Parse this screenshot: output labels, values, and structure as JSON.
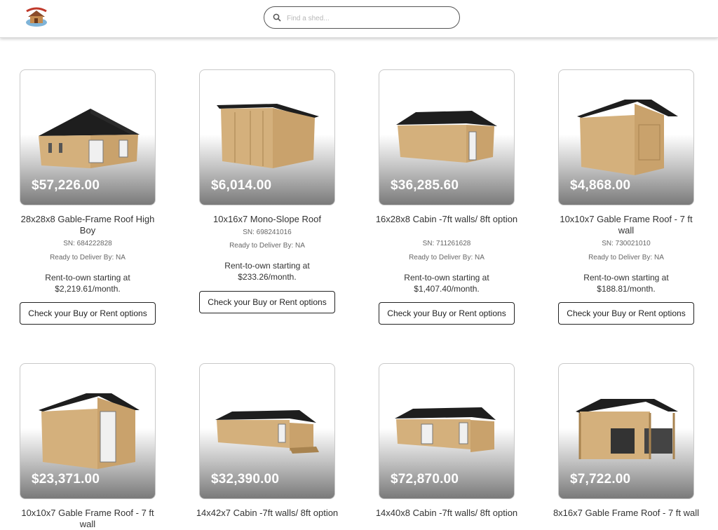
{
  "header": {
    "logo_alt": "logo",
    "search": {
      "placeholder": "Find a shed..."
    }
  },
  "products": [
    {
      "price": "$57,226.00",
      "title": "28x28x8 Gable-Frame Roof High Boy",
      "sn": "SN: 684222828",
      "ready": "Ready to Deliver By: NA",
      "rent": "Rent-to-own starting at $2,219.61/month.",
      "button": "Check your Buy or Rent options",
      "image": "gable-house"
    },
    {
      "price": "$6,014.00",
      "title": "10x16x7 Mono-Slope Roof",
      "sn": "SN: 698241016",
      "ready": "Ready to Deliver By: NA",
      "rent": "Rent-to-own starting at $233.26/month.",
      "button": "Check your Buy or Rent options",
      "image": "mono-slope"
    },
    {
      "price": "$36,285.60",
      "title": "16x28x8 Cabin -7ft walls/ 8ft option",
      "sn": "SN: 711261628",
      "ready": "Ready to Deliver By: NA",
      "rent": "Rent-to-own starting at $1,407.40/month.",
      "button": "Check your Buy or Rent options",
      "image": "cabin"
    },
    {
      "price": "$4,868.00",
      "title": "10x10x7 Gable Frame Roof - 7 ft wall",
      "sn": "SN: 730021010",
      "ready": "Ready to Deliver By: NA",
      "rent": "Rent-to-own starting at $188.81/month.",
      "button": "Check your Buy or Rent options",
      "image": "gable-shed"
    },
    {
      "price": "$23,371.00",
      "title": "10x10x7 Gable Frame Roof - 7 ft wall",
      "image": "gable-door"
    },
    {
      "price": "$32,390.00",
      "title": "14x42x7 Cabin -7ft walls/ 8ft option",
      "image": "long-cabin"
    },
    {
      "price": "$72,870.00",
      "title": "14x40x8 Cabin -7ft walls/ 8ft option",
      "image": "long-cabin-2"
    },
    {
      "price": "$7,722.00",
      "title": "8x16x7 Gable Frame Roof - 7 ft wall",
      "image": "porch-shed"
    }
  ]
}
